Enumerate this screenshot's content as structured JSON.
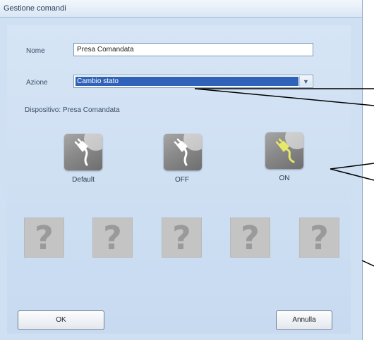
{
  "window": {
    "title": "Gestione comandi"
  },
  "form": {
    "nome_label": "Nome",
    "nome_value": "Presa Comandata",
    "azione_label": "Azione",
    "azione_value": "Cambio stato",
    "dispositivo_text": "Dispositivo: Presa Comandata"
  },
  "states": [
    {
      "label": "Default",
      "icon": "plug-icon",
      "color": "#ffffff"
    },
    {
      "label": "OFF",
      "icon": "plug-icon",
      "color": "#ffffff"
    },
    {
      "label": "ON",
      "icon": "plug-on-icon",
      "color": "#e6e86a"
    }
  ],
  "placeholders": [
    "?",
    "?",
    "?",
    "?",
    "?"
  ],
  "buttons": {
    "ok": "OK",
    "cancel": "Annulla"
  }
}
